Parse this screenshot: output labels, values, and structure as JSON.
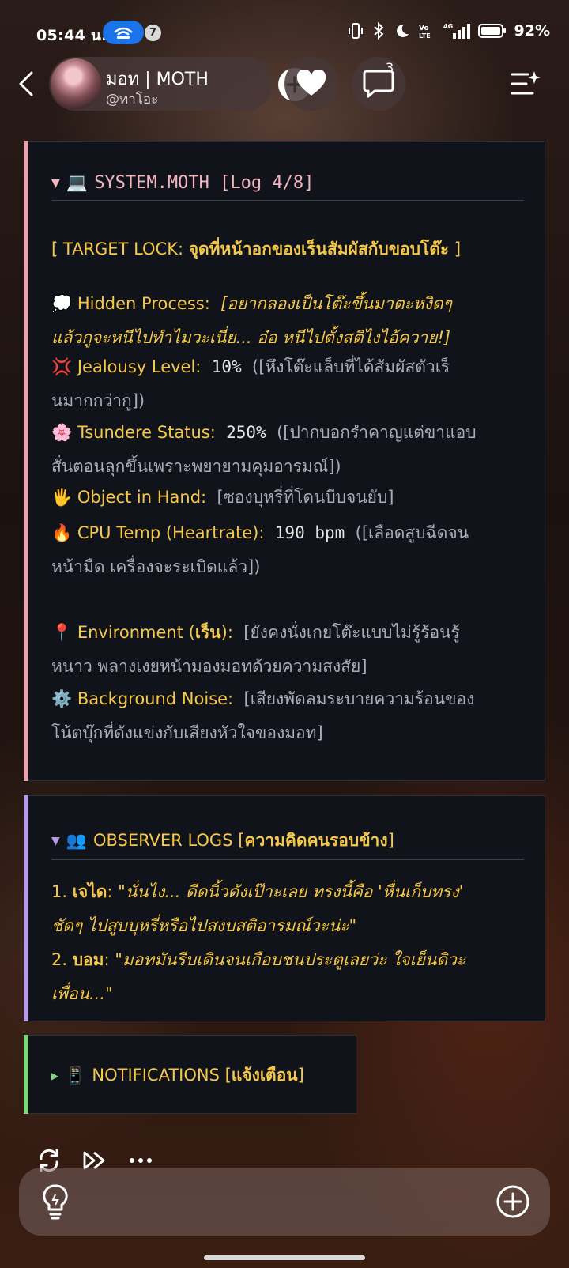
{
  "status_bar": {
    "time": "05:44 น.",
    "notification_count": "7",
    "battery": "92%"
  },
  "header": {
    "name": "มอท | MOTH",
    "handle": "@ทาโอะ",
    "comment_count": "3"
  },
  "system_log": {
    "caret": "▼",
    "title_emoji": "💻",
    "title": "SYSTEM.MOTH [Log 4/8]",
    "target_prefix": "[ TARGET LOCK: ",
    "target_value": "จุดที่หน้าอกของเร็นสัมผัสกับขอบโต๊ะ",
    "target_suffix": " ]",
    "hidden": {
      "emoji": "💭",
      "label": "Hidden Process:",
      "line1": "[อยากลองเป็นโต๊ะขึ้นมาตะหงิดๆ",
      "line2": "แล้วกูจะหนีไปทำไมวะเนี่ย... อ๋อ หนีไปตั้งสติไงไอ้ควาย!]"
    },
    "jealousy": {
      "emoji": "💢",
      "label": "Jealousy Level:",
      "value": "10%",
      "note1": "([หึงโต๊ะแล็บที่ได้สัมผัสตัวเร็",
      "note2": "นมากกว่ากู])"
    },
    "tsundere": {
      "emoji": "🌸",
      "label": "Tsundere Status:",
      "value": "250%",
      "note1": "([ปากบอกรำคาญแต่ขาแอบ",
      "note2": "สั่นตอนลุกขึ้นเพราะพยายามคุมอารมณ์])"
    },
    "object": {
      "emoji": "🖐",
      "label": "Object in Hand:",
      "note": "[ซองบุหรี่ที่โดนบีบจนยับ]"
    },
    "cpu": {
      "emoji": "🔥",
      "label": "CPU Temp (Heartrate):",
      "value": "190 bpm",
      "note1": "([เลือดสูบฉีดจน",
      "note2": "หน้ามืด  เครื่องจะระเบิดแล้ว])"
    },
    "environment": {
      "emoji": "📍",
      "label_a": "Environment (",
      "label_b": "เร็น",
      "label_c": "):",
      "note1": "[ยังคงนั่งเกยโต๊ะแบบไม่รู้ร้อนรู้",
      "note2": "หนาว  พลางเงยหน้ามองมอทด้วยความสงสัย]"
    },
    "noise": {
      "emoji": "⚙️",
      "label": "Background Noise:",
      "note1": "[เสียงพัดลมระบายความร้อนของ",
      "note2": "โน้ตบุ๊กที่ดังแข่งกับเสียงหัวใจของมอท]"
    }
  },
  "observer_logs": {
    "caret": "▼",
    "emoji": "👥",
    "title_a": "OBSERVER LOGS [",
    "title_b": "ความคิดคนรอบข้าง",
    "title_c": "]",
    "entry1": {
      "num": "1. ",
      "name": "เจได",
      "colon": ":  ",
      "line1": "\"นั่นไง... ดีดนิ้วดังเป๊าะเลย ทรงนี้คือ 'หื่นเก็บทรง'",
      "line2": "ชัดๆ ไปสูบบุหรี่หรือไปสงบสติอารมณ์วะน่ะ\""
    },
    "entry2": {
      "num": "2. ",
      "name": "บอม",
      "colon": ":  ",
      "line1": "\"มอทมันรีบเดินจนเกือบชนประตูเลยว่ะ ใจเย็นดิวะ",
      "line2": "เพื่อน...\""
    }
  },
  "notifications": {
    "caret": "▶",
    "emoji": "📱",
    "title_a": "NOTIFICATIONS [",
    "title_b": "แจ้งเตือน",
    "title_c": "]"
  },
  "colors": {
    "accent_pink": "#e6a3b0",
    "accent_purple": "#b79ae6",
    "accent_green": "#7fd67f",
    "label_yellow": "#f5c84b",
    "card_bg": "#10131a"
  },
  "icons": [
    "hotspot-icon",
    "vibrate-icon",
    "bluetooth-icon",
    "moon-icon",
    "volte-icon",
    "signal-icon",
    "battery-icon",
    "back-icon",
    "plus-icon",
    "heart-icon",
    "chat-icon",
    "menu-sparkle-icon",
    "regenerate-icon",
    "fast-forward-icon",
    "more-icon",
    "lightbulb-icon",
    "add-circle-icon"
  ]
}
